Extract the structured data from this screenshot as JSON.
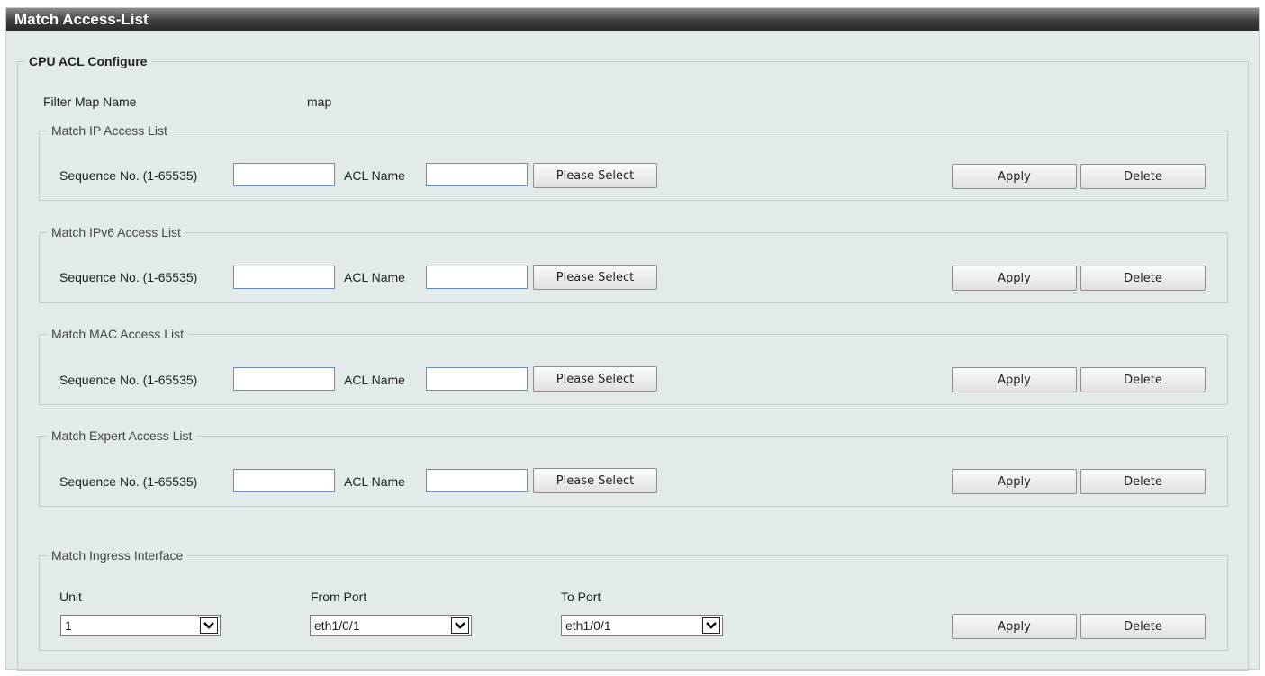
{
  "page": {
    "title": "Match Access-List"
  },
  "config": {
    "legend": "CPU ACL Configure",
    "filter_map_label": "Filter Map Name",
    "filter_map_value": "map"
  },
  "groups": [
    {
      "legend": "Match IP Access List",
      "seq_label": "Sequence No. (1-65535)",
      "seq_value": "",
      "acl_label": "ACL Name",
      "acl_value": "",
      "select_label": "Please Select",
      "apply_label": "Apply",
      "delete_label": "Delete"
    },
    {
      "legend": "Match IPv6 Access List",
      "seq_label": "Sequence No. (1-65535)",
      "seq_value": "",
      "acl_label": "ACL Name",
      "acl_value": "",
      "select_label": "Please Select",
      "apply_label": "Apply",
      "delete_label": "Delete"
    },
    {
      "legend": "Match MAC Access List",
      "seq_label": "Sequence No. (1-65535)",
      "seq_value": "",
      "acl_label": "ACL Name",
      "acl_value": "",
      "select_label": "Please Select",
      "apply_label": "Apply",
      "delete_label": "Delete"
    },
    {
      "legend": "Match Expert Access List",
      "seq_label": "Sequence No. (1-65535)",
      "seq_value": "",
      "acl_label": "ACL Name",
      "acl_value": "",
      "select_label": "Please Select",
      "apply_label": "Apply",
      "delete_label": "Delete"
    }
  ],
  "ingress": {
    "legend": "Match Ingress Interface",
    "unit_label": "Unit",
    "unit_value": "1",
    "from_label": "From Port",
    "from_value": "eth1/0/1",
    "to_label": "To Port",
    "to_value": "eth1/0/1",
    "apply_label": "Apply",
    "delete_label": "Delete"
  },
  "icons": {
    "dropdown": "chevron-down-icon"
  }
}
